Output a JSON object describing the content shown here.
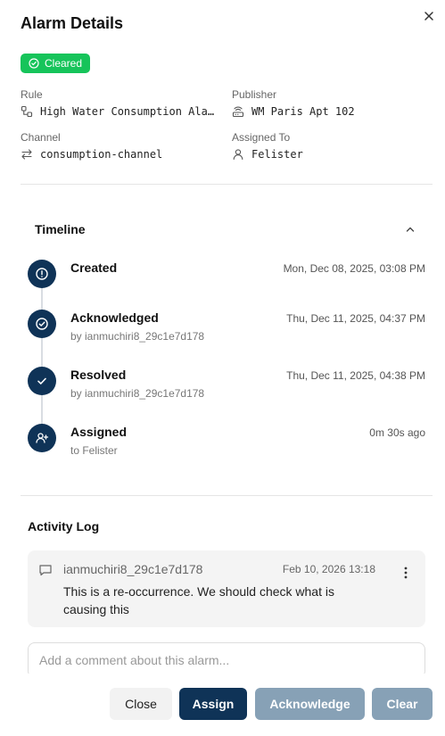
{
  "dialog": {
    "title": "Alarm Details",
    "status": "Cleared",
    "status_color": "#16c45a"
  },
  "meta": {
    "rule_label": "Rule",
    "rule_value": "High Water Consumption Ala…",
    "publisher_label": "Publisher",
    "publisher_value": "WM Paris Apt 102",
    "channel_label": "Channel",
    "channel_value": "consumption-channel",
    "assigned_label": "Assigned To",
    "assigned_value": "Felister"
  },
  "timeline": {
    "title": "Timeline",
    "items": [
      {
        "label": "Created",
        "sub": "",
        "time": "Mon, Dec 08, 2025, 03:08 PM",
        "icon": "alert-circle-icon"
      },
      {
        "label": "Acknowledged",
        "sub": "by ianmuchiri8_29c1e7d178",
        "time": "Thu, Dec 11, 2025, 04:37 PM",
        "icon": "check-circle-icon"
      },
      {
        "label": "Resolved",
        "sub": "by ianmuchiri8_29c1e7d178",
        "time": "Thu, Dec 11, 2025, 04:38 PM",
        "icon": "check-icon"
      },
      {
        "label": "Assigned",
        "sub": "to Felister",
        "time": "0m 30s ago",
        "icon": "user-plus-icon"
      }
    ]
  },
  "activity": {
    "title": "Activity Log",
    "entries": [
      {
        "user": "ianmuchiri8_29c1e7d178",
        "time": "Feb 10, 2026 13:18",
        "text": "This is a re-occurrence. We should check what is causing this"
      }
    ],
    "comment_placeholder": "Add a comment about this alarm..."
  },
  "footer": {
    "close": "Close",
    "assign": "Assign",
    "acknowledge": "Acknowledge",
    "clear": "Clear"
  },
  "colors": {
    "primary": "#0f3357",
    "disabled": "#87a1b6"
  }
}
